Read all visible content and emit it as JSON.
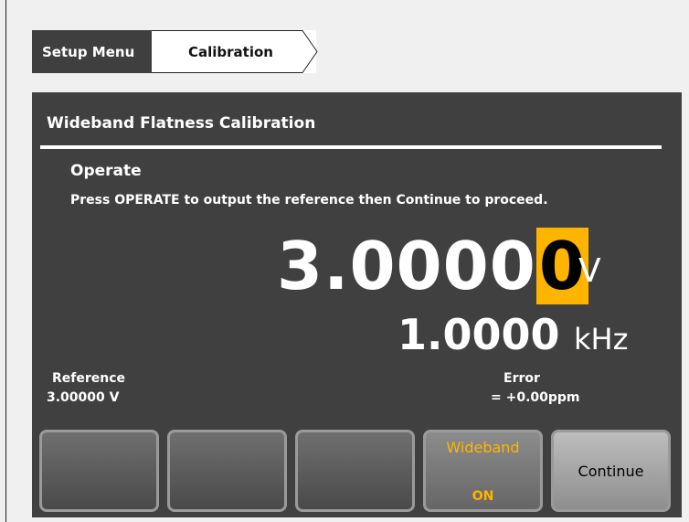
{
  "breadcrumb": {
    "item1": "Setup Menu",
    "item2": "Calibration"
  },
  "panel": {
    "title": "Wideband Flatness Calibration",
    "operate_heading": "Operate",
    "operate_text": "Press OPERATE to output the reference then Continue to proceed."
  },
  "reading": {
    "main_digits": "3.0000",
    "cursor_digit": "0",
    "main_unit": "V",
    "freq_value": "1.0000",
    "freq_unit": "kHz"
  },
  "reference": {
    "label": "Reference",
    "value": "3.00000 V"
  },
  "error": {
    "label": "Error",
    "value": "=   +0.00ppm"
  },
  "softkeys": {
    "key1": "",
    "key2": "",
    "key3": "",
    "wideband_label": "Wideband",
    "wideband_state": "ON",
    "continue_label": "Continue"
  },
  "colors": {
    "accent": "#ffb400",
    "panel": "#404040",
    "background": "#f0f0f0"
  }
}
